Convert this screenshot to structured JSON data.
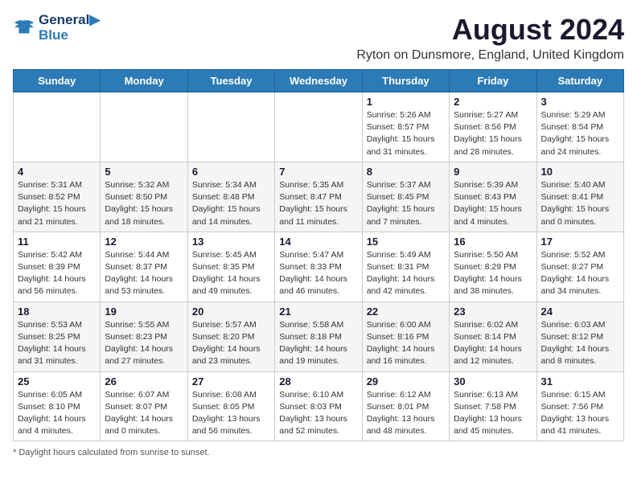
{
  "header": {
    "logo_line1": "General",
    "logo_line2": "Blue",
    "title": "August 2024",
    "subtitle": "Ryton on Dunsmore, England, United Kingdom"
  },
  "columns": [
    "Sunday",
    "Monday",
    "Tuesday",
    "Wednesday",
    "Thursday",
    "Friday",
    "Saturday"
  ],
  "weeks": [
    [
      {
        "day": "",
        "info": ""
      },
      {
        "day": "",
        "info": ""
      },
      {
        "day": "",
        "info": ""
      },
      {
        "day": "",
        "info": ""
      },
      {
        "day": "1",
        "info": "Sunrise: 5:26 AM\nSunset: 8:57 PM\nDaylight: 15 hours\nand 31 minutes."
      },
      {
        "day": "2",
        "info": "Sunrise: 5:27 AM\nSunset: 8:56 PM\nDaylight: 15 hours\nand 28 minutes."
      },
      {
        "day": "3",
        "info": "Sunrise: 5:29 AM\nSunset: 8:54 PM\nDaylight: 15 hours\nand 24 minutes."
      }
    ],
    [
      {
        "day": "4",
        "info": "Sunrise: 5:31 AM\nSunset: 8:52 PM\nDaylight: 15 hours\nand 21 minutes."
      },
      {
        "day": "5",
        "info": "Sunrise: 5:32 AM\nSunset: 8:50 PM\nDaylight: 15 hours\nand 18 minutes."
      },
      {
        "day": "6",
        "info": "Sunrise: 5:34 AM\nSunset: 8:48 PM\nDaylight: 15 hours\nand 14 minutes."
      },
      {
        "day": "7",
        "info": "Sunrise: 5:35 AM\nSunset: 8:47 PM\nDaylight: 15 hours\nand 11 minutes."
      },
      {
        "day": "8",
        "info": "Sunrise: 5:37 AM\nSunset: 8:45 PM\nDaylight: 15 hours\nand 7 minutes."
      },
      {
        "day": "9",
        "info": "Sunrise: 5:39 AM\nSunset: 8:43 PM\nDaylight: 15 hours\nand 4 minutes."
      },
      {
        "day": "10",
        "info": "Sunrise: 5:40 AM\nSunset: 8:41 PM\nDaylight: 15 hours\nand 0 minutes."
      }
    ],
    [
      {
        "day": "11",
        "info": "Sunrise: 5:42 AM\nSunset: 8:39 PM\nDaylight: 14 hours\nand 56 minutes."
      },
      {
        "day": "12",
        "info": "Sunrise: 5:44 AM\nSunset: 8:37 PM\nDaylight: 14 hours\nand 53 minutes."
      },
      {
        "day": "13",
        "info": "Sunrise: 5:45 AM\nSunset: 8:35 PM\nDaylight: 14 hours\nand 49 minutes."
      },
      {
        "day": "14",
        "info": "Sunrise: 5:47 AM\nSunset: 8:33 PM\nDaylight: 14 hours\nand 46 minutes."
      },
      {
        "day": "15",
        "info": "Sunrise: 5:49 AM\nSunset: 8:31 PM\nDaylight: 14 hours\nand 42 minutes."
      },
      {
        "day": "16",
        "info": "Sunrise: 5:50 AM\nSunset: 8:29 PM\nDaylight: 14 hours\nand 38 minutes."
      },
      {
        "day": "17",
        "info": "Sunrise: 5:52 AM\nSunset: 8:27 PM\nDaylight: 14 hours\nand 34 minutes."
      }
    ],
    [
      {
        "day": "18",
        "info": "Sunrise: 5:53 AM\nSunset: 8:25 PM\nDaylight: 14 hours\nand 31 minutes."
      },
      {
        "day": "19",
        "info": "Sunrise: 5:55 AM\nSunset: 8:23 PM\nDaylight: 14 hours\nand 27 minutes."
      },
      {
        "day": "20",
        "info": "Sunrise: 5:57 AM\nSunset: 8:20 PM\nDaylight: 14 hours\nand 23 minutes."
      },
      {
        "day": "21",
        "info": "Sunrise: 5:58 AM\nSunset: 8:18 PM\nDaylight: 14 hours\nand 19 minutes."
      },
      {
        "day": "22",
        "info": "Sunrise: 6:00 AM\nSunset: 8:16 PM\nDaylight: 14 hours\nand 16 minutes."
      },
      {
        "day": "23",
        "info": "Sunrise: 6:02 AM\nSunset: 8:14 PM\nDaylight: 14 hours\nand 12 minutes."
      },
      {
        "day": "24",
        "info": "Sunrise: 6:03 AM\nSunset: 8:12 PM\nDaylight: 14 hours\nand 8 minutes."
      }
    ],
    [
      {
        "day": "25",
        "info": "Sunrise: 6:05 AM\nSunset: 8:10 PM\nDaylight: 14 hours\nand 4 minutes."
      },
      {
        "day": "26",
        "info": "Sunrise: 6:07 AM\nSunset: 8:07 PM\nDaylight: 14 hours\nand 0 minutes."
      },
      {
        "day": "27",
        "info": "Sunrise: 6:08 AM\nSunset: 8:05 PM\nDaylight: 13 hours\nand 56 minutes."
      },
      {
        "day": "28",
        "info": "Sunrise: 6:10 AM\nSunset: 8:03 PM\nDaylight: 13 hours\nand 52 minutes."
      },
      {
        "day": "29",
        "info": "Sunrise: 6:12 AM\nSunset: 8:01 PM\nDaylight: 13 hours\nand 48 minutes."
      },
      {
        "day": "30",
        "info": "Sunrise: 6:13 AM\nSunset: 7:58 PM\nDaylight: 13 hours\nand 45 minutes."
      },
      {
        "day": "31",
        "info": "Sunrise: 6:15 AM\nSunset: 7:56 PM\nDaylight: 13 hours\nand 41 minutes."
      }
    ]
  ],
  "footer": "Daylight hours"
}
